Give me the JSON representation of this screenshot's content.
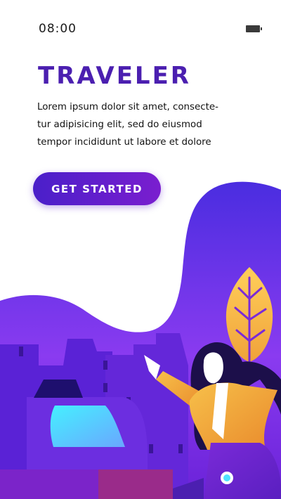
{
  "status_bar": {
    "time": "08:00",
    "battery_icon": "battery-icon"
  },
  "onboarding": {
    "title": "TRAVELER",
    "description_lines": [
      "Lorem ipsum dolor sit amet, consecte-",
      "tur adipisicing elit, sed do eiusmod",
      "tempor incididunt ut labore et dolore"
    ],
    "cta_label": "GET STARTED"
  },
  "colors": {
    "brand_purple": "#4b1fb0",
    "button_gradient_start": "#4a1fc9",
    "button_gradient_end": "#7a1ecf",
    "accent_yellow": "#f4b53a",
    "accent_cyan": "#4fe3ff"
  }
}
